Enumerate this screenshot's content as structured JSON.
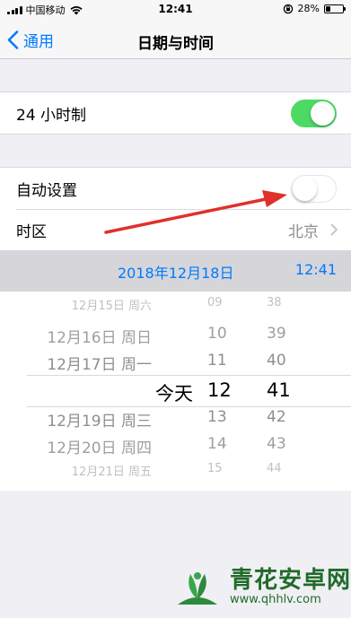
{
  "status_bar": {
    "carrier": "中国移动",
    "time": "12:41",
    "battery_pct": "28%",
    "battery_level": 0.28,
    "icons": [
      "signal-icon",
      "wifi-icon",
      "orientation-lock-icon",
      "battery-icon"
    ]
  },
  "nav": {
    "back_label": "通用",
    "title": "日期与时间"
  },
  "settings": {
    "hour24": {
      "label": "24 小时制",
      "on": true
    },
    "auto_set": {
      "label": "自动设置",
      "on": false
    },
    "timezone": {
      "label": "时区",
      "value": "北京"
    }
  },
  "current": {
    "date": "2018年12月18日",
    "time": "12:41"
  },
  "picker": {
    "rows": [
      {
        "date": "12月15日 周六",
        "hour": "09",
        "minute": "38"
      },
      {
        "date": "12月16日 周日",
        "hour": "10",
        "minute": "39"
      },
      {
        "date": "12月17日 周一",
        "hour": "11",
        "minute": "40"
      },
      {
        "date": "今天",
        "hour": "12",
        "minute": "41"
      },
      {
        "date": "12月19日 周三",
        "hour": "13",
        "minute": "42"
      },
      {
        "date": "12月20日 周四",
        "hour": "14",
        "minute": "43"
      },
      {
        "date": "12月21日 周五",
        "hour": "15",
        "minute": "44"
      }
    ]
  },
  "watermark": {
    "title": "青花安卓网",
    "url": "www.qhhlv.com"
  },
  "colors": {
    "accent": "#007aff",
    "switch_on": "#4cd964",
    "arrow": "#e0302a",
    "watermark": "#1f6b29"
  }
}
